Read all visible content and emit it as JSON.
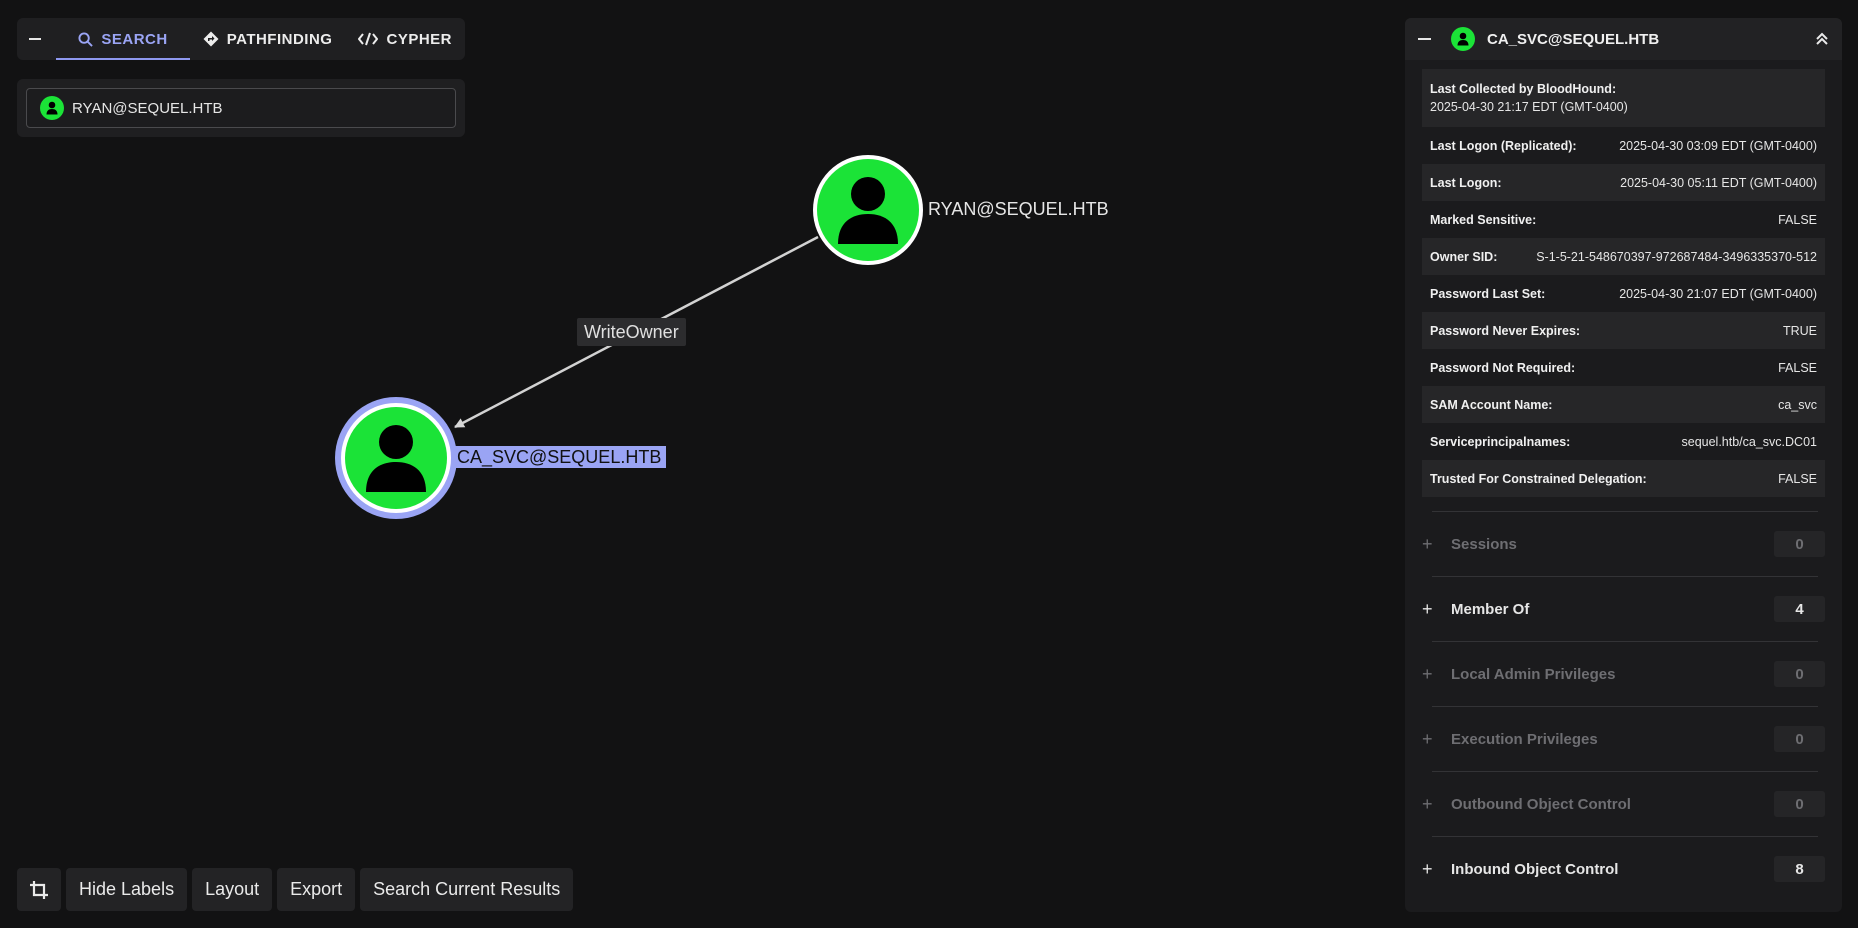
{
  "tabs": [
    {
      "label": "SEARCH",
      "icon": "search-icon"
    },
    {
      "label": "PATHFINDING",
      "icon": "route-icon"
    },
    {
      "label": "CYPHER",
      "icon": "code-icon"
    }
  ],
  "search": {
    "value": "RYAN@SEQUEL.HTB"
  },
  "graph": {
    "nodes": [
      {
        "label": "RYAN@SEQUEL.HTB",
        "type": "user",
        "color": "#1be337"
      },
      {
        "label": "CA_SVC@SEQUEL.HTB",
        "type": "user",
        "color": "#1be337",
        "selected": true
      }
    ],
    "edge_label": "WriteOwner",
    "selection_color": "#9aa4f4"
  },
  "toolbar": {
    "hide_labels": "Hide Labels",
    "layout": "Layout",
    "export": "Export",
    "search_results": "Search Current Results"
  },
  "panel": {
    "title": "CA_SVC@SEQUEL.HTB",
    "props": [
      {
        "k": "Last Collected by BloodHound:",
        "v": "2025-04-30 21:17 EDT (GMT-0400)"
      },
      {
        "k": "Last Logon (Replicated):",
        "v": "2025-04-30 03:09 EDT (GMT-0400)"
      },
      {
        "k": "Last Logon:",
        "v": "2025-04-30 05:11 EDT (GMT-0400)"
      },
      {
        "k": "Marked Sensitive:",
        "v": "FALSE"
      },
      {
        "k": "Owner SID:",
        "v": "S-1-5-21-548670397-972687484-3496335370-512"
      },
      {
        "k": "Password Last Set:",
        "v": "2025-04-30 21:07 EDT (GMT-0400)"
      },
      {
        "k": "Password Never Expires:",
        "v": "TRUE"
      },
      {
        "k": "Password Not Required:",
        "v": "FALSE"
      },
      {
        "k": "SAM Account Name:",
        "v": "ca_svc"
      },
      {
        "k": "Serviceprincipalnames:",
        "v": "sequel.htb/ca_svc.DC01"
      },
      {
        "k": "Trusted For Constrained Delegation:",
        "v": "FALSE"
      }
    ],
    "sections": [
      {
        "label": "Sessions",
        "count": "0",
        "muted": true
      },
      {
        "label": "Member Of",
        "count": "4",
        "muted": false
      },
      {
        "label": "Local Admin Privileges",
        "count": "0",
        "muted": true
      },
      {
        "label": "Execution Privileges",
        "count": "0",
        "muted": true
      },
      {
        "label": "Outbound Object Control",
        "count": "0",
        "muted": true
      },
      {
        "label": "Inbound Object Control",
        "count": "8",
        "muted": false
      }
    ]
  }
}
